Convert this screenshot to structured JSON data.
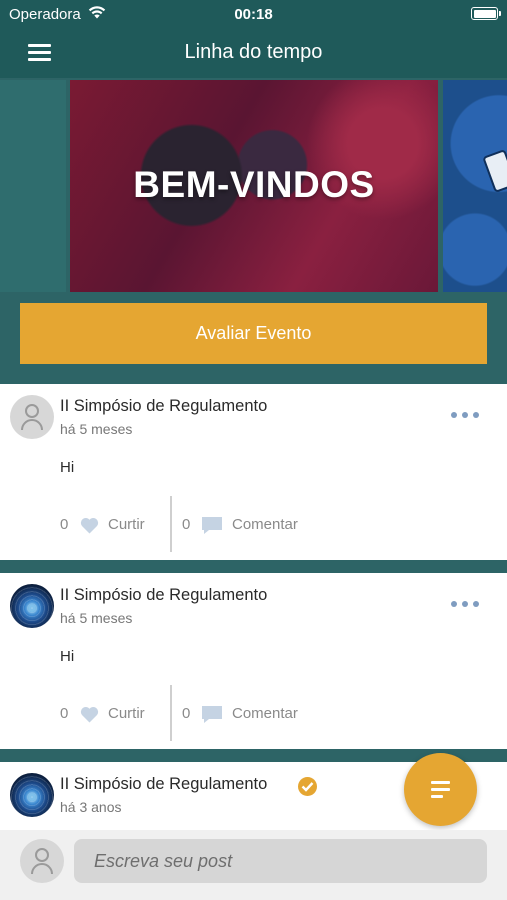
{
  "status_bar": {
    "carrier": "Operadora",
    "time": "00:18",
    "wifi_icon": "wifi-icon",
    "battery_icon": "battery-icon"
  },
  "header": {
    "title": "Linha do tempo",
    "menu_icon": "hamburger-menu-icon"
  },
  "banner": {
    "text": "BEM-VINDOS"
  },
  "rate_button": {
    "label": "Avaliar Evento"
  },
  "posts": [
    {
      "author": "II Simpósio de Regulamento",
      "time_ago": "há 5 meses",
      "content": "Hi",
      "likes": "0",
      "like_label": "Curtir",
      "comments": "0",
      "comment_label": "Comentar",
      "verified": false,
      "avatar": "placeholder"
    },
    {
      "author": "II Simpósio de Regulamento",
      "time_ago": "há 5 meses",
      "content": "Hi",
      "likes": "0",
      "like_label": "Curtir",
      "comments": "0",
      "comment_label": "Comentar",
      "verified": false,
      "avatar": "photo"
    },
    {
      "author": "II Simpósio de Regulamento",
      "time_ago": "há 3 anos",
      "verified": true,
      "avatar": "photo"
    }
  ],
  "compose": {
    "placeholder": "Escreva seu post"
  },
  "colors": {
    "primary": "#1f5a5a",
    "background": "#2d6466",
    "accent": "#e5a632",
    "icon_muted": "#c5d3e3"
  }
}
